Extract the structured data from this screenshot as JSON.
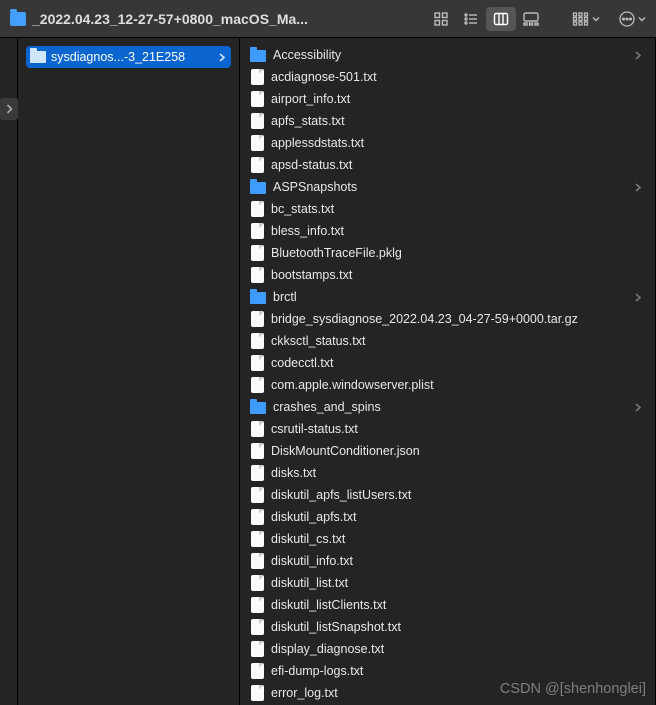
{
  "toolbar": {
    "title": "_2022.04.23_12-27-57+0800_macOS_Ma..."
  },
  "column1": {
    "selected_label": "sysdiagnos...-3_21E258"
  },
  "column2": {
    "items": [
      {
        "name": "Accessibility",
        "type": "folder"
      },
      {
        "name": "acdiagnose-501.txt",
        "type": "file"
      },
      {
        "name": "airport_info.txt",
        "type": "file"
      },
      {
        "name": "apfs_stats.txt",
        "type": "file"
      },
      {
        "name": "applessdstats.txt",
        "type": "file"
      },
      {
        "name": "apsd-status.txt",
        "type": "file"
      },
      {
        "name": "ASPSnapshots",
        "type": "folder"
      },
      {
        "name": "bc_stats.txt",
        "type": "file"
      },
      {
        "name": "bless_info.txt",
        "type": "file"
      },
      {
        "name": "BluetoothTraceFile.pklg",
        "type": "file"
      },
      {
        "name": "bootstamps.txt",
        "type": "file"
      },
      {
        "name": "brctl",
        "type": "folder"
      },
      {
        "name": "bridge_sysdiagnose_2022.04.23_04-27-59+0000.tar.gz",
        "type": "file"
      },
      {
        "name": "ckksctl_status.txt",
        "type": "file"
      },
      {
        "name": "codecctl.txt",
        "type": "file"
      },
      {
        "name": "com.apple.windowserver.plist",
        "type": "file"
      },
      {
        "name": "crashes_and_spins",
        "type": "folder"
      },
      {
        "name": "csrutil-status.txt",
        "type": "file"
      },
      {
        "name": "DiskMountConditioner.json",
        "type": "file"
      },
      {
        "name": "disks.txt",
        "type": "file"
      },
      {
        "name": "diskutil_apfs_listUsers.txt",
        "type": "file"
      },
      {
        "name": "diskutil_apfs.txt",
        "type": "file"
      },
      {
        "name": "diskutil_cs.txt",
        "type": "file"
      },
      {
        "name": "diskutil_info.txt",
        "type": "file"
      },
      {
        "name": "diskutil_list.txt",
        "type": "file"
      },
      {
        "name": "diskutil_listClients.txt",
        "type": "file"
      },
      {
        "name": "diskutil_listSnapshot.txt",
        "type": "file"
      },
      {
        "name": "display_diagnose.txt",
        "type": "file"
      },
      {
        "name": "efi-dump-logs.txt",
        "type": "file"
      },
      {
        "name": "error_log.txt",
        "type": "file"
      }
    ]
  },
  "watermark": "CSDN @[shenhonglei]"
}
